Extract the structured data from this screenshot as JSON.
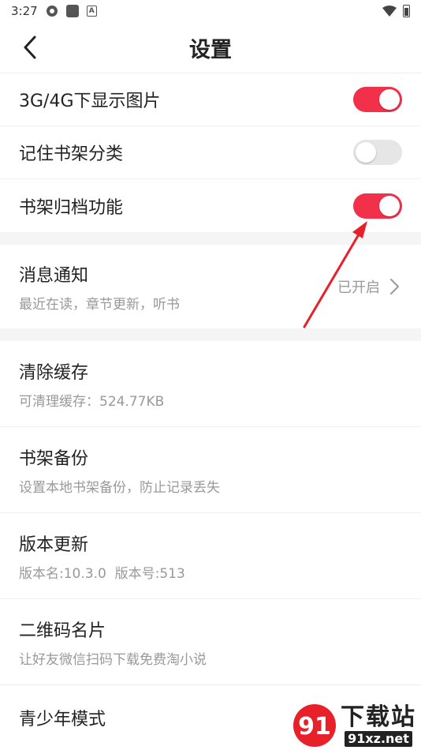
{
  "status_bar": {
    "time": "3:27"
  },
  "header": {
    "title": "设置"
  },
  "toggles": [
    {
      "label": "3G/4G下显示图片",
      "on": true
    },
    {
      "label": "记住书架分类",
      "on": false
    },
    {
      "label": "书架归档功能",
      "on": true
    }
  ],
  "notification": {
    "title": "消息通知",
    "subtitle": "最近在读，章节更新，听书",
    "value": "已开启"
  },
  "items": [
    {
      "title": "清除缓存",
      "subtitle": "可清理缓存：524.77KB"
    },
    {
      "title": "书架备份",
      "subtitle": "设置本地书架备份，防止记录丢失"
    },
    {
      "title": "版本更新",
      "subtitle": "版本名:10.3.0  版本号:513"
    },
    {
      "title": "二维码名片",
      "subtitle": "让好友微信扫码下载免费淘小说"
    },
    {
      "title": "青少年模式",
      "subtitle": ""
    }
  ],
  "watermark": {
    "cn": "下载站",
    "en": "91xz.net"
  },
  "colors": {
    "accent": "#f2304a",
    "toggle_off": "#e6e6e6",
    "subtext": "#999999",
    "divider_bg": "#f5f5f5"
  }
}
